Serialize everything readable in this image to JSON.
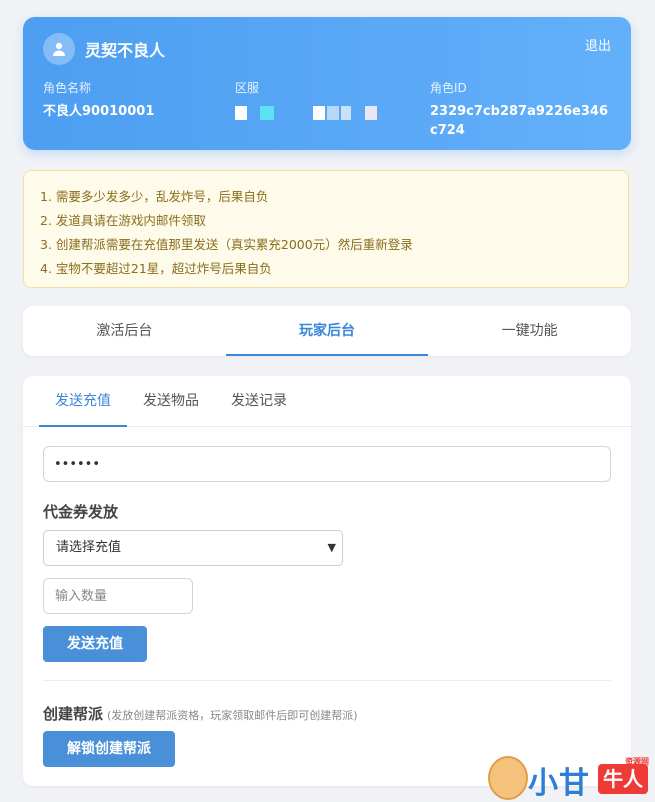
{
  "header": {
    "title": "灵契不良人",
    "logout": "退出",
    "fields": [
      {
        "label": "角色名称",
        "value": "不良人90010001"
      },
      {
        "label": "区服",
        "value": ""
      },
      {
        "label": "角色ID",
        "value": "2329c7cb287a9226e346c724"
      }
    ]
  },
  "notice": {
    "lines": [
      "1. 需要多少发多少，乱发炸号，后果自负",
      "2. 发道具请在游戏内邮件领取",
      "3. 创建帮派需要在充值那里发送（真实累充2000元）然后重新登录",
      "4. 宝物不要超过21星，超过炸号后果自负"
    ]
  },
  "main_tabs": [
    "激活后台",
    "玩家后台",
    "一键功能"
  ],
  "main_tab_active": "玩家后台",
  "sub_tabs": [
    "发送充值",
    "发送物品",
    "发送记录"
  ],
  "sub_tab_active": "发送充值",
  "form": {
    "password_value": "••••••",
    "voucher_title": "代金券发放",
    "select_value": "请选择充值",
    "qty_placeholder": "输入数量",
    "send_button": "发送充值",
    "guild_title": "创建帮派",
    "guild_hint": "(发放创建帮派资格，玩家领取邮件后即可创建帮派)",
    "guild_button": "解锁创建帮派"
  },
  "watermark": {
    "text1": "小甘",
    "text2": "牛人",
    "tag": "资源网"
  },
  "colors": {
    "accent": "#3a86d8",
    "button": "#4a90d9",
    "header": "#55a4f5",
    "notice_bg": "#fffbea"
  }
}
